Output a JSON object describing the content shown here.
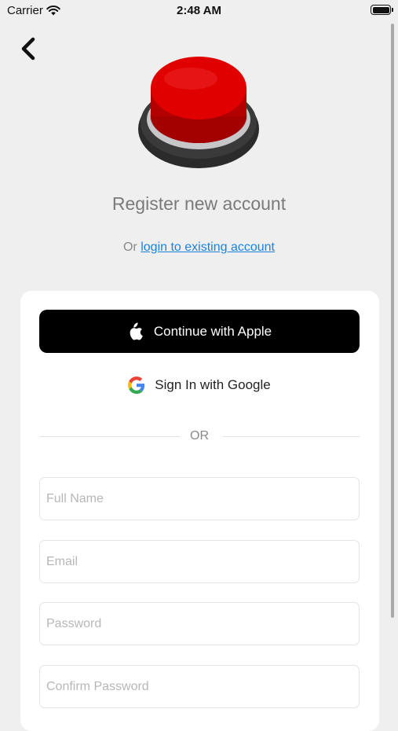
{
  "status_bar": {
    "carrier": "Carrier",
    "time": "2:48 AM"
  },
  "header": {
    "title": "Register new account",
    "login_prefix": "Or",
    "login_link": "login to existing account"
  },
  "icons": {
    "back": "chevron-left-icon",
    "logo": "red-push-button-icon",
    "apple": "apple-logo-icon",
    "google": "google-g-icon",
    "wifi": "wifi-icon",
    "battery": "battery-icon"
  },
  "social": {
    "apple_label": "Continue with Apple",
    "google_label": "Sign In with Google"
  },
  "divider": {
    "label": "OR"
  },
  "form": {
    "full_name_placeholder": "Full Name",
    "email_placeholder": "Email",
    "password_placeholder": "Password",
    "confirm_password_placeholder": "Confirm Password"
  },
  "colors": {
    "background": "#efeff0",
    "link": "#1a83e0",
    "button_red": "#d40000",
    "apple_button": "#000000"
  }
}
